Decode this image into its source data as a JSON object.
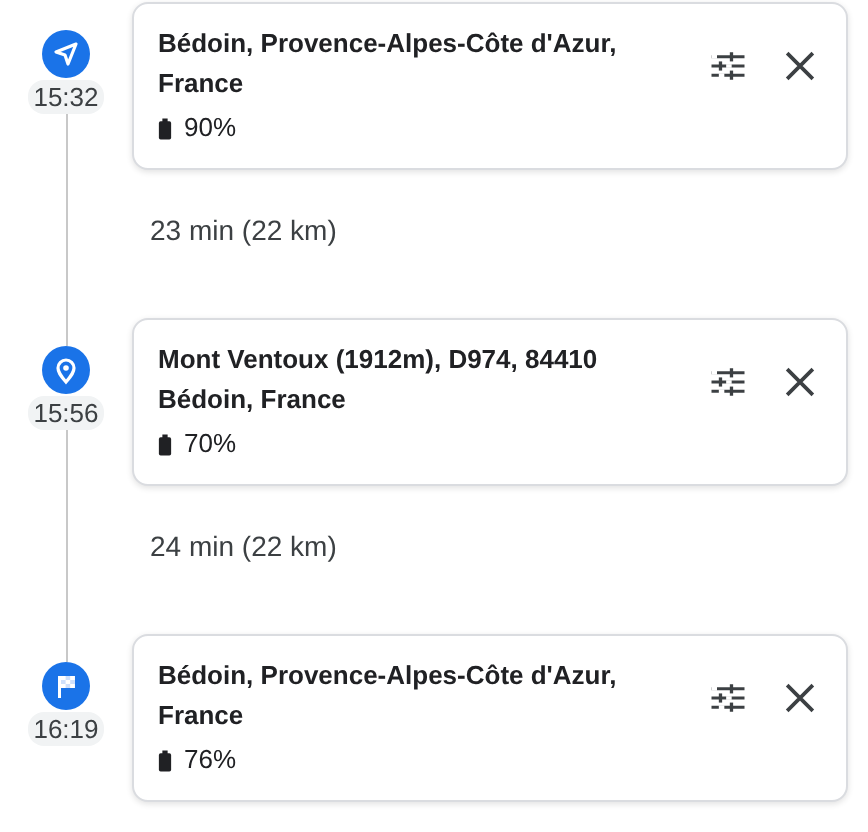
{
  "route": [
    {
      "kind": "start",
      "time": "15:32",
      "address": "Bédoin, Provence-Alpes-Côte d'Azur, France",
      "battery": "90%"
    },
    {
      "kind": "leg",
      "summary": "23 min (22 km)"
    },
    {
      "kind": "waypoint",
      "time": "15:56",
      "address": "Mont Ventoux (1912m), D974, 84410 Bédoin, France",
      "battery": "70%"
    },
    {
      "kind": "leg",
      "summary": "24 min (22 km)"
    },
    {
      "kind": "finish",
      "time": "16:19",
      "address": "Bédoin, Provence-Alpes-Côte d'Azur, France",
      "battery": "76%"
    }
  ]
}
